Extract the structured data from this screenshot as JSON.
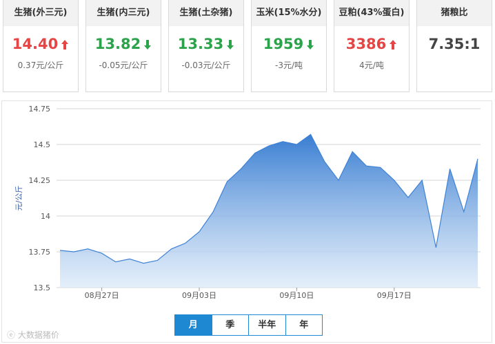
{
  "cards": [
    {
      "title": "生猪(外三元)",
      "price": "14.40",
      "change": "0.37元/公斤",
      "trend": "up"
    },
    {
      "title": "生猪(内三元)",
      "price": "13.82",
      "change": "-0.05元/公斤",
      "trend": "down"
    },
    {
      "title": "生猪(土杂猪)",
      "price": "13.33",
      "change": "-0.03元/公斤",
      "trend": "down"
    },
    {
      "title": "玉米(15%水分)",
      "price": "1959",
      "change": "-3元/吨",
      "trend": "down"
    },
    {
      "title": "豆粕(43%蛋白)",
      "price": "3386",
      "change": "4元/吨",
      "trend": "up"
    },
    {
      "title": "猪粮比",
      "price": "7.35:1",
      "change": "",
      "trend": "none"
    }
  ],
  "colors": {
    "up": "#e64545",
    "down": "#2aa34a",
    "accent": "#1e88d2",
    "line": "#3f82d4"
  },
  "chart_data": {
    "type": "area",
    "ylabel": "元/公斤",
    "ylim": [
      13.5,
      14.75
    ],
    "yticks": [
      "14.75",
      "14.5",
      "14.25",
      "14",
      "13.75",
      "13.5"
    ],
    "xtick_labels": [
      "08月27日",
      "09月03日",
      "09月10日",
      "09月17日"
    ],
    "xtick_index": [
      3,
      10,
      17,
      24
    ],
    "values": [
      13.76,
      13.75,
      13.77,
      13.74,
      13.68,
      13.7,
      13.67,
      13.69,
      13.77,
      13.81,
      13.89,
      14.03,
      14.24,
      14.33,
      14.44,
      14.49,
      14.52,
      14.5,
      14.57,
      14.38,
      14.25,
      14.45,
      14.35,
      14.34,
      14.25,
      14.13,
      14.25,
      13.78,
      14.33,
      14.03,
      14.4
    ]
  },
  "tabs": [
    "月",
    "季",
    "半年",
    "年"
  ],
  "watermark": "大数据猪价"
}
